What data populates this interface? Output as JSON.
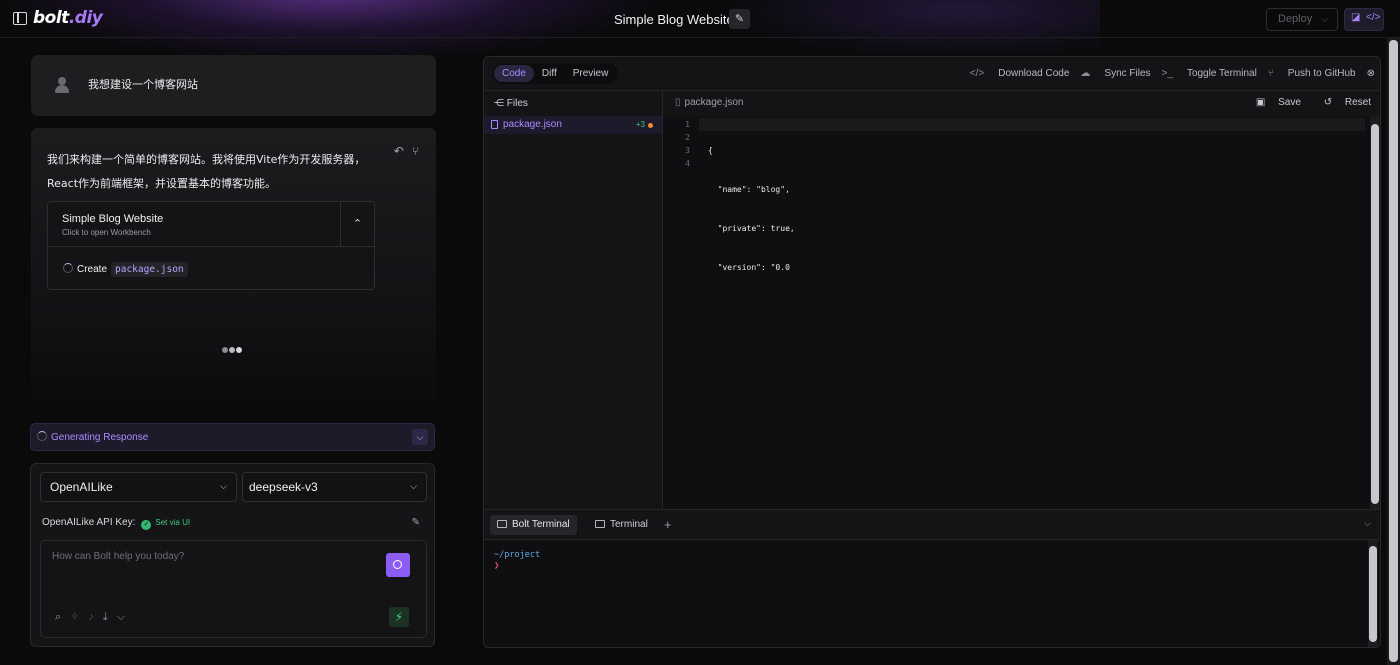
{
  "header": {
    "logo_main": "bolt",
    "logo_accent": ".diy",
    "project_title": "Simple Blog Website",
    "deploy_label": "Deploy"
  },
  "chat": {
    "user_message": "我想建设一个博客网站",
    "ai_message_line1": "我们来构建一个简单的博客网站。我将使用Vite作为开发服务器，",
    "ai_message_line2": "React作为前端框架，并设置基本的博客功能。",
    "artifact": {
      "title": "Simple Blog Website",
      "subtitle": "Click to open Workbench",
      "action_label": "Create",
      "action_file": "package.json"
    },
    "generating_label": "Generating Response"
  },
  "input": {
    "provider": "OpenAILike",
    "model": "deepseek-v3",
    "api_key_label": "OpenAILike API Key:",
    "api_key_status": "Set via UI",
    "placeholder": "How can Bolt help you today?"
  },
  "workbench": {
    "tabs": [
      "Code",
      "Diff",
      "Preview"
    ],
    "active_tab": "Code",
    "actions": {
      "download": "Download Code",
      "sync": "Sync Files",
      "toggle_terminal": "Toggle Terminal",
      "push": "Push to GitHub"
    },
    "files_label": "Files",
    "file": {
      "name": "package.json",
      "badge": "+3"
    },
    "editor": {
      "open_file": "package.json",
      "save_label": "Save",
      "reset_label": "Reset",
      "line_numbers": [
        "1",
        "2",
        "3",
        "4"
      ],
      "lines": [
        "{",
        "  \"name\": \"blog\",",
        "  \"private\": true,",
        "  \"version\": \"0.0"
      ]
    },
    "terminal": {
      "tabs": [
        "Bolt Terminal",
        "Terminal"
      ],
      "path": "~/project",
      "prompt": "❯"
    }
  }
}
